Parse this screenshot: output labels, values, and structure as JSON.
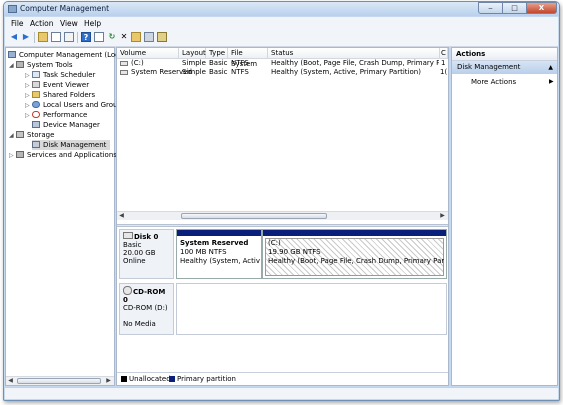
{
  "window": {
    "title": "Computer Management",
    "minimize": "‒",
    "maximize": "□",
    "close": "X"
  },
  "menu": [
    "File",
    "Action",
    "View",
    "Help"
  ],
  "toolbar": {
    "icons": [
      "back-arrow-icon",
      "forward-arrow-icon",
      "up-folder-icon",
      "show-hide-tree-icon",
      "properties-icon",
      "help-icon",
      "console-view-icon",
      "refresh-icon",
      "delete-icon",
      "open-icon",
      "rescan-disks-icon",
      "disk-properties-icon"
    ]
  },
  "tree": {
    "root": "Computer Management (Local",
    "system_tools": "System Tools",
    "task_scheduler": "Task Scheduler",
    "event_viewer": "Event Viewer",
    "shared_folders": "Shared Folders",
    "local_users": "Local Users and Groups",
    "performance": "Performance",
    "device_manager": "Device Manager",
    "storage": "Storage",
    "disk_management": "Disk Management",
    "services": "Services and Applications"
  },
  "volume_table": {
    "headers": [
      "Volume",
      "Layout",
      "Type",
      "File System",
      "Status",
      "C"
    ],
    "rows": [
      {
        "volume": "(C:)",
        "layout": "Simple",
        "type": "Basic",
        "fs": "NTFS",
        "status": "Healthy (Boot, Page File, Crash Dump, Primary Partition)",
        "c": "1"
      },
      {
        "volume": "System Reserved",
        "layout": "Simple",
        "type": "Basic",
        "fs": "NTFS",
        "status": "Healthy (System, Active, Primary Partition)",
        "c": "1("
      }
    ]
  },
  "disks": {
    "disk0": {
      "name": "Disk 0",
      "kind": "Basic",
      "size": "20.00 GB",
      "state": "Online",
      "partitions": [
        {
          "name": "System Reserved",
          "size": "100 MB NTFS",
          "status": "Healthy (System, Active, P"
        },
        {
          "name": "(C:)",
          "size": "19.90 GB NTFS",
          "status": "Healthy (Boot, Page File, Crash Dump, Primary Partition)"
        }
      ]
    },
    "cdrom0": {
      "name": "CD-ROM 0",
      "drive": "CD-ROM (D:)",
      "media": "No Media"
    }
  },
  "legend": {
    "unallocated": "Unallocated",
    "primary": "Primary partition",
    "unallocated_color": "#000000",
    "primary_color": "#0a1f7a"
  },
  "actions": {
    "title": "Actions",
    "section": "Disk Management",
    "more": "More Actions"
  }
}
